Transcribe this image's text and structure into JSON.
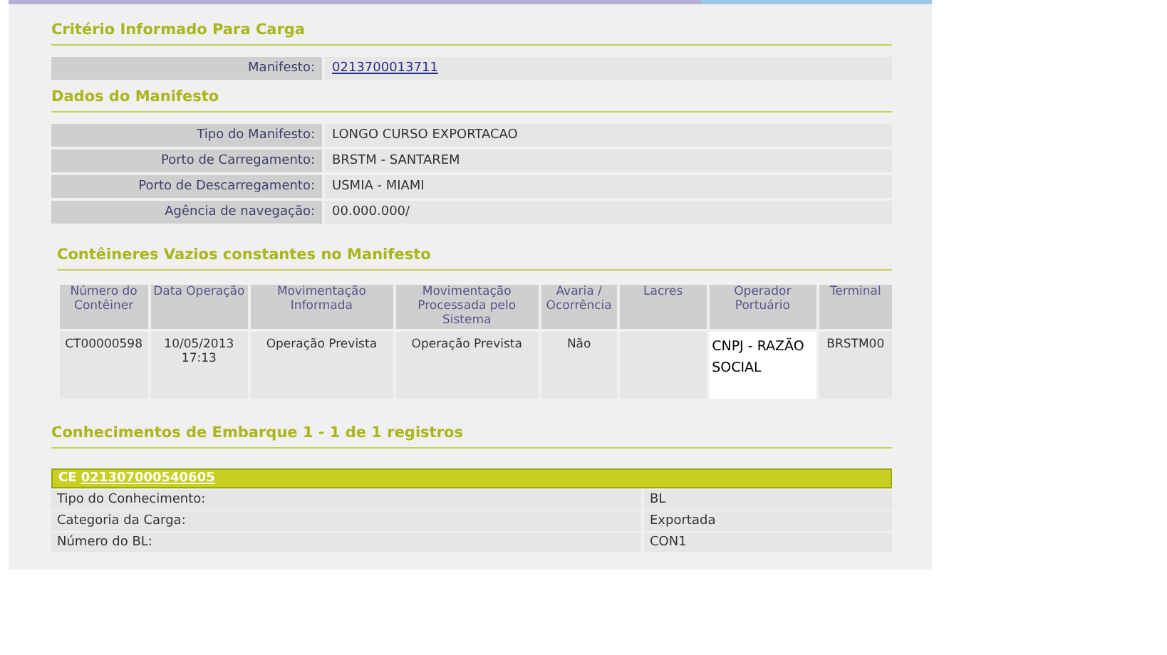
{
  "criteria": {
    "title": "Critério Informado Para Carga",
    "rows": [
      {
        "label": "Manifesto:",
        "value": "0213700013711"
      }
    ]
  },
  "manifest": {
    "title": "Dados do Manifesto",
    "rows": [
      {
        "label": "Tipo do Manifesto:",
        "value": "LONGO CURSO EXPORTACAO"
      },
      {
        "label": "Porto de Carregamento:",
        "value": "BRSTM - SANTAREM"
      },
      {
        "label": "Porto de Descarregamento:",
        "value": "USMIA - MIAMI"
      },
      {
        "label": "Agência de navegação:",
        "value": "00.000.000/"
      }
    ]
  },
  "containers": {
    "title": "Contêineres Vazios constantes no Manifesto",
    "columns": [
      "Número do Contêiner",
      "Data Operação",
      "Movimentação Informada",
      "Movimentação Processada pelo Sistema",
      "Avaria / Ocorrência",
      "Lacres",
      "Operador Portuário",
      "Terminal"
    ],
    "rows": [
      [
        "CT00000598",
        "10/05/2013 17:13",
        "Operação Prevista",
        "Operação Prevista",
        "Não",
        "",
        "CNPJ - RAZÃO SOCIAL",
        "BRSTM00"
      ]
    ]
  },
  "bills": {
    "title": "Conhecimentos de Embarque 1 - 1 de 1 registros",
    "prefix": "CE",
    "number": "021307000540605",
    "rows": [
      {
        "label": "Tipo do Conhecimento:",
        "value": "BL"
      },
      {
        "label": "Categoria da Carga:",
        "value": "Exportada"
      },
      {
        "label": "Número do BL:",
        "value": "CON1"
      }
    ]
  }
}
